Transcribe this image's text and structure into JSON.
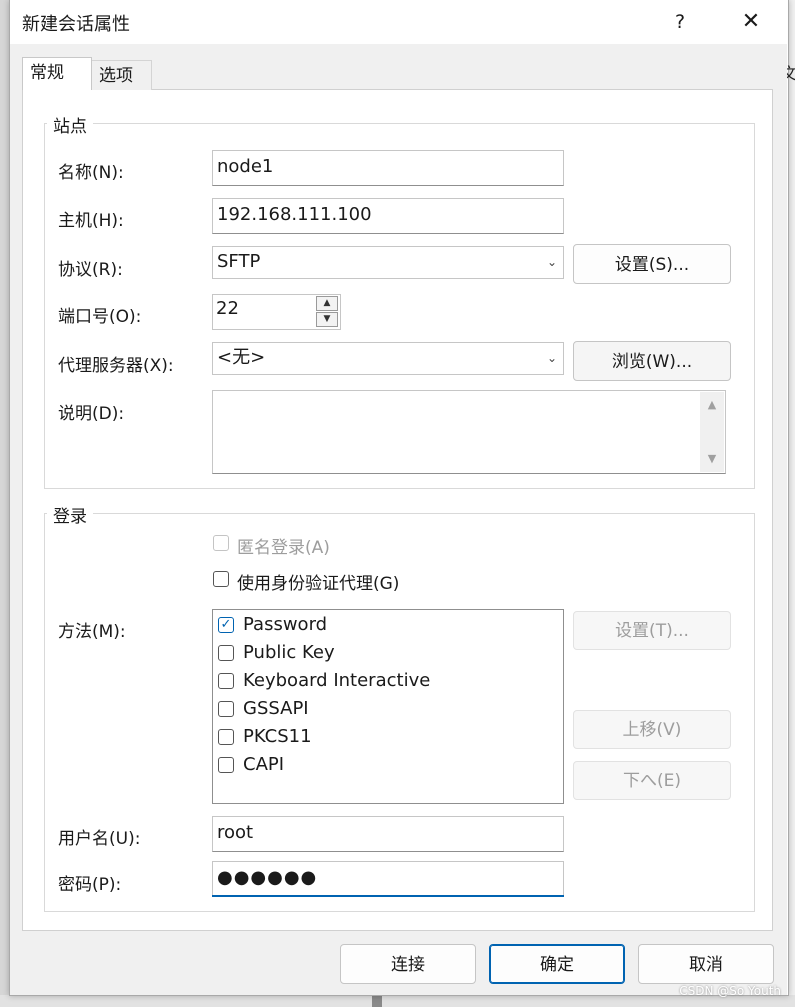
{
  "window": {
    "title": "新建会话属性",
    "help_label": "?",
    "close_label": "✕",
    "background_glyph": "文"
  },
  "tabs": [
    {
      "label": "常规",
      "active": true
    },
    {
      "label": "选项",
      "active": false
    }
  ],
  "site": {
    "caption": "站点",
    "name_label": "名称(N):",
    "name_value": "node1",
    "host_label": "主机(H):",
    "host_value": "192.168.111.100",
    "protocol_label": "协议(R):",
    "protocol_value": "SFTP",
    "protocol_settings_button": "设置(S)...",
    "port_label": "端口号(O):",
    "port_value": "22",
    "proxy_label": "代理服务器(X):",
    "proxy_value": "<无>",
    "browse_button": "浏览(W)...",
    "description_label": "说明(D):",
    "description_value": ""
  },
  "login": {
    "caption": "登录",
    "anonymous_label": "匿名登录(A)",
    "anonymous_checked": false,
    "anonymous_enabled": false,
    "agent_label": "使用身份验证代理(G)",
    "agent_checked": false,
    "method_label": "方法(M):",
    "methods": [
      {
        "label": "Password",
        "checked": true
      },
      {
        "label": "Public Key",
        "checked": false
      },
      {
        "label": "Keyboard Interactive",
        "checked": false
      },
      {
        "label": "GSSAPI",
        "checked": false
      },
      {
        "label": "PKCS11",
        "checked": false
      },
      {
        "label": "CAPI",
        "checked": false
      }
    ],
    "method_settings_button": "设置(T)...",
    "move_up_button": "上移(V)",
    "move_down_button": "下へ(E)",
    "username_label": "用户名(U):",
    "username_value": "root",
    "password_label": "密码(P):",
    "password_mask": "●●●●●●"
  },
  "footer": {
    "connect_button": "连接",
    "ok_button": "确定",
    "cancel_button": "取消"
  },
  "watermark": "CSDN @So Youth",
  "colors": {
    "accent": "#0063b1",
    "dialog_bg": "#f0f0f0",
    "disabled_text": "#9d9d9d"
  }
}
